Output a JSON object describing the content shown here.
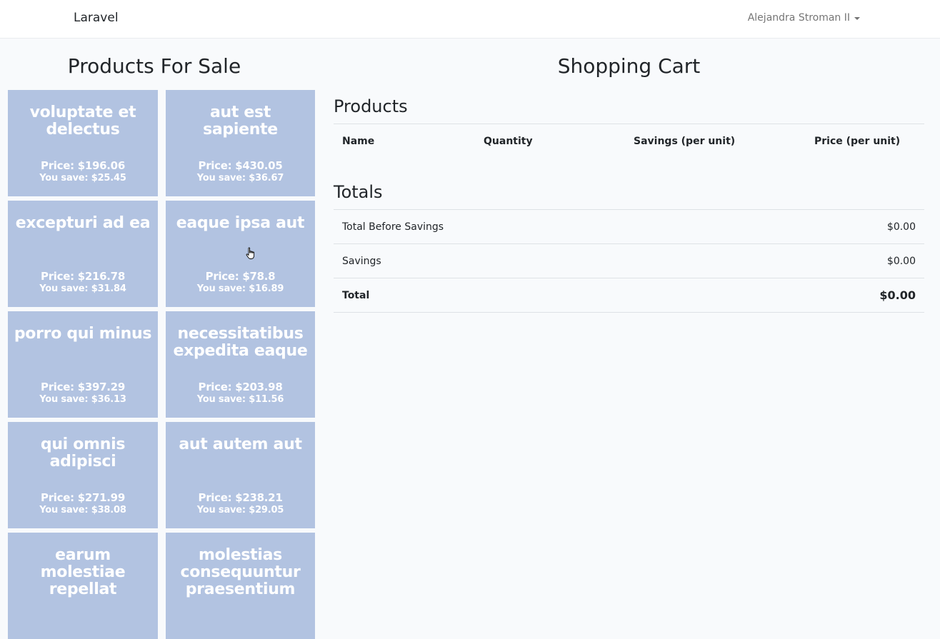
{
  "navbar": {
    "brand": "Laravel",
    "user_name": "Alejandra Stroman II"
  },
  "products_for_sale": {
    "heading": "Products For Sale",
    "items": [
      {
        "name": "voluptate et delectus",
        "price": "Price: $196.06",
        "savings": "You save: $25.45"
      },
      {
        "name": "aut est sapiente",
        "price": "Price: $430.05",
        "savings": "You save: $36.67"
      },
      {
        "name": "excepturi ad ea",
        "price": "Price: $216.78",
        "savings": "You save: $31.84"
      },
      {
        "name": "eaque ipsa aut",
        "price": "Price: $78.8",
        "savings": "You save: $16.89"
      },
      {
        "name": "porro qui minus",
        "price": "Price: $397.29",
        "savings": "You save: $36.13"
      },
      {
        "name": "necessitatibus expedita eaque",
        "price": "Price: $203.98",
        "savings": "You save: $11.56"
      },
      {
        "name": "qui omnis adipisci",
        "price": "Price: $271.99",
        "savings": "You save: $38.08"
      },
      {
        "name": "aut autem aut",
        "price": "Price: $238.21",
        "savings": "You save: $29.05"
      },
      {
        "name": "earum molestiae repellat",
        "price": "",
        "savings": ""
      },
      {
        "name": "molestias consequuntur praesentium",
        "price": "",
        "savings": ""
      }
    ]
  },
  "cart": {
    "heading": "Shopping Cart",
    "products_heading": "Products",
    "columns": [
      "Name",
      "Quantity",
      "Savings (per unit)",
      "Price (per unit)"
    ],
    "totals_heading": "Totals",
    "totals": [
      {
        "label": "Total Before Savings",
        "value": "$0.00"
      },
      {
        "label": "Savings",
        "value": "$0.00"
      },
      {
        "label": "Total",
        "value": "$0.00"
      }
    ]
  },
  "colors": {
    "card_background": "#b2c3e1",
    "page_background": "#f8fafc"
  }
}
